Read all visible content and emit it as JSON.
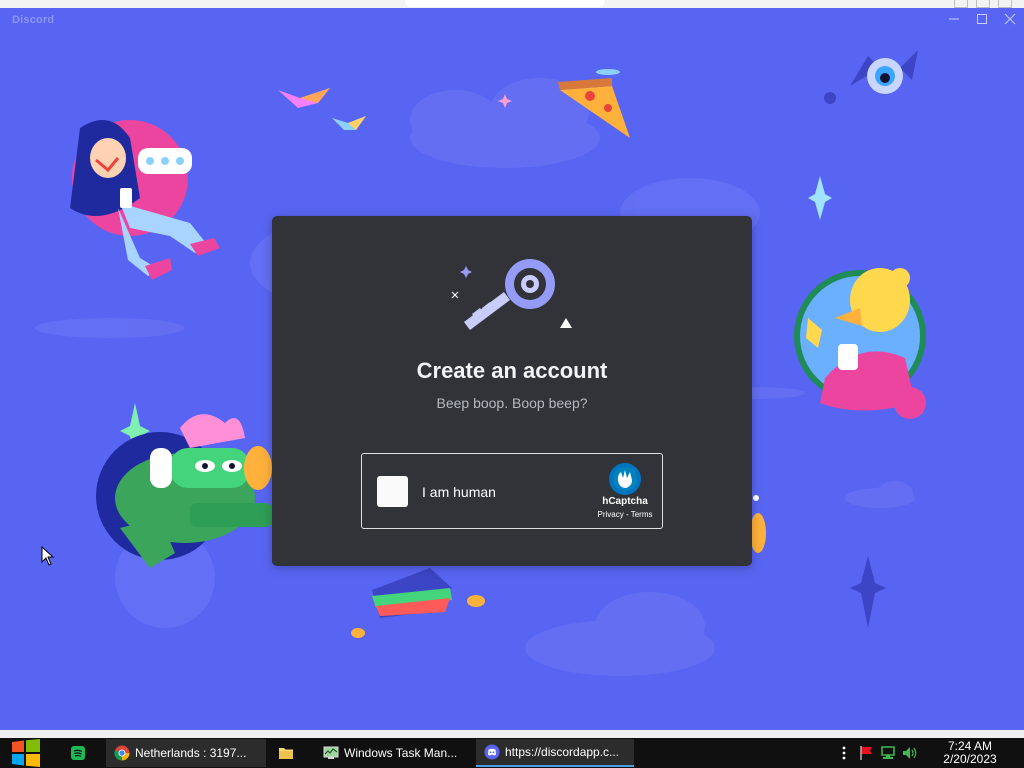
{
  "window": {
    "app_title": "Discord"
  },
  "modal": {
    "title": "Create an account",
    "subtitle": "Beep boop. Boop beep?"
  },
  "captcha": {
    "checkbox_label": "I am human",
    "brand": "hCaptcha",
    "privacy_link": "Privacy",
    "separator": "-",
    "terms_link": "Terms"
  },
  "taskbar": {
    "apps": [
      {
        "name": "spotify",
        "label": "",
        "icon": "spotify-icon"
      },
      {
        "name": "chrome",
        "label": "Netherlands : 3197...",
        "icon": "chrome-icon"
      },
      {
        "name": "explorer",
        "label": "",
        "icon": "folder-icon"
      },
      {
        "name": "task-manager",
        "label": "Windows Task Man...",
        "icon": "task-manager-icon"
      },
      {
        "name": "discord",
        "label": "https://discordapp.c...",
        "icon": "discord-icon"
      }
    ],
    "clock": {
      "time": "7:24 AM",
      "date": "2/20/2023"
    }
  },
  "colors": {
    "background": "#5865f2",
    "modal": "#313338",
    "title_text": "#f2f3f5",
    "subtitle_text": "#b5bac1",
    "taskbar": "#101010"
  }
}
